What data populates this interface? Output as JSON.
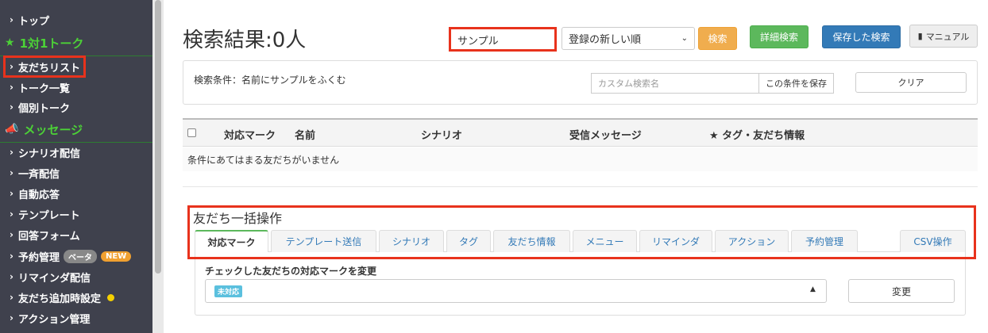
{
  "sidebar": {
    "items": [
      {
        "label": "トップ"
      },
      {
        "label": "友だちリスト"
      },
      {
        "label": "トーク一覧"
      },
      {
        "label": "個別トーク"
      },
      {
        "label": "シナリオ配信"
      },
      {
        "label": "一斉配信"
      },
      {
        "label": "自動応答"
      },
      {
        "label": "テンプレート"
      },
      {
        "label": "回答フォーム"
      },
      {
        "label": "予約管理"
      },
      {
        "label": "リマインダ配信"
      },
      {
        "label": "友だち追加時設定"
      },
      {
        "label": "アクション管理"
      }
    ],
    "sections": [
      {
        "label": "1対1トーク",
        "icon": "star-icon"
      },
      {
        "label": "メッセージ",
        "icon": "megaphone-icon"
      }
    ],
    "badges": {
      "beta": "ベータ",
      "new": "NEW"
    }
  },
  "header": {
    "title": "検索結果:0人",
    "search_value": "サンプル",
    "sort_selected": "登録の新しい順",
    "search_button": "検索",
    "advanced_button": "詳細検索",
    "saved_button": "保存した検索",
    "manual_button": "マニュアル"
  },
  "conditions": {
    "text": "検索条件：名前にサンプルをふくむ",
    "custom_name_placeholder": "カスタム検索名",
    "save_button": "この条件を保存",
    "clear_button": "クリア"
  },
  "table": {
    "headers": [
      "対応マーク",
      "名前",
      "シナリオ",
      "受信メッセージ",
      "★ タグ・友だち情報"
    ],
    "empty_message": "条件にあてはまる友だちがいません"
  },
  "bulk": {
    "title": "友だち一括操作",
    "tabs": [
      "対応マーク",
      "テンプレート送信",
      "シナリオ",
      "タグ",
      "友だち情報",
      "メニュー",
      "リマインダ",
      "アクション",
      "予約管理",
      "CSV操作"
    ],
    "panel_label": "チェックした友だちの対応マークを変更",
    "mark_value": "未対応",
    "change_button": "変更"
  },
  "colors": {
    "sidebar_bg": "#3f414d",
    "section_green": "#4cd137",
    "highlight_red": "#e8321c"
  }
}
